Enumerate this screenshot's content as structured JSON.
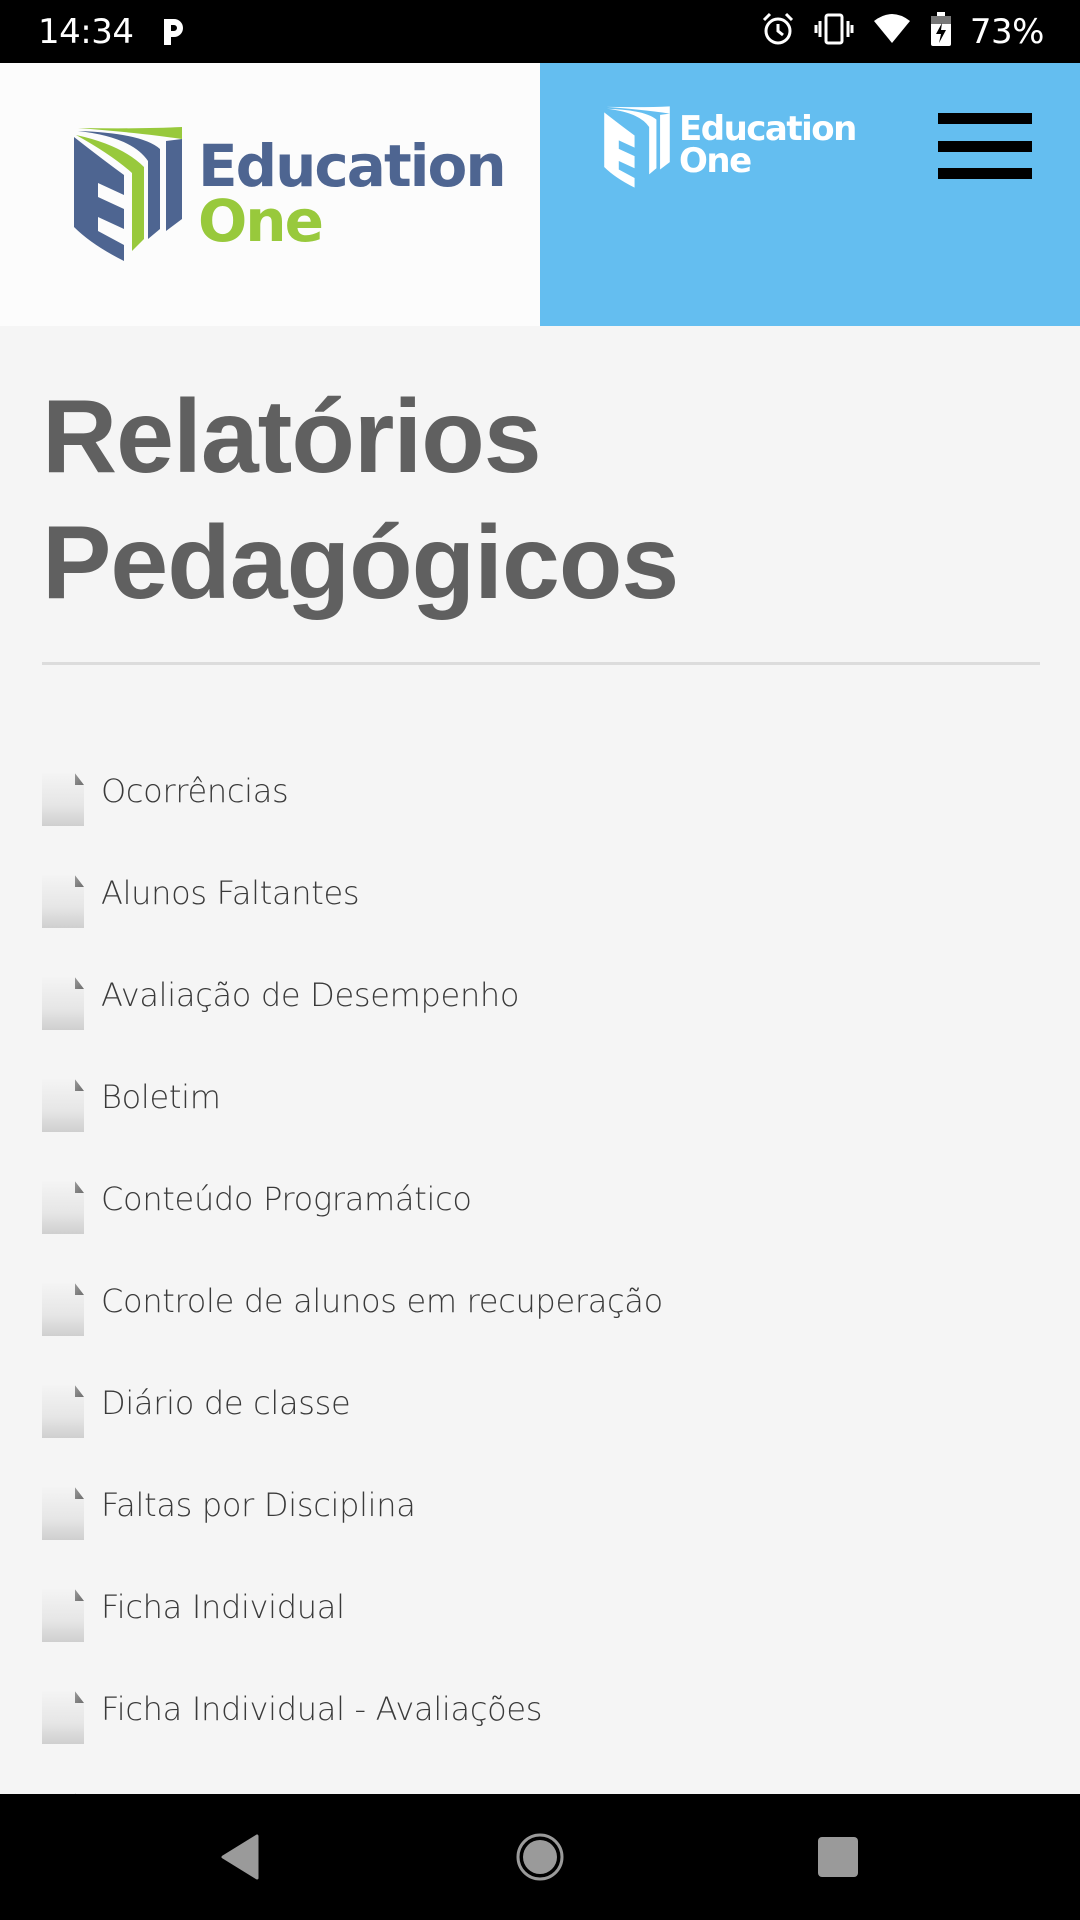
{
  "status_bar": {
    "time": "14:34",
    "notification_icon": "parking-p-icon",
    "icons": [
      "alarm-icon",
      "vibrate-icon",
      "wifi-icon",
      "battery-charging-icon"
    ],
    "battery_percent": "73%"
  },
  "header": {
    "logo_primary": {
      "line1": "Education",
      "line2": "One"
    },
    "logo_secondary": {
      "line1": "Education",
      "line2": "One"
    },
    "menu_icon": "hamburger-menu-icon",
    "colors": {
      "left_bg": "#fcfcfc",
      "right_bg": "#64bef0",
      "brand_blue": "#4e6591",
      "brand_green": "#98c93c"
    }
  },
  "main": {
    "title_line1": "Relatórios",
    "title_line2": "Pedagógicos",
    "reports": [
      {
        "label": "Ocorrências",
        "icon": "document-icon"
      },
      {
        "label": "Alunos Faltantes",
        "icon": "document-icon"
      },
      {
        "label": "Avaliação de Desempenho",
        "icon": "document-icon"
      },
      {
        "label": "Boletim",
        "icon": "document-icon"
      },
      {
        "label": "Conteúdo Programático",
        "icon": "document-icon"
      },
      {
        "label": "Controle de alunos em recuperação",
        "icon": "document-icon"
      },
      {
        "label": "Diário de classe",
        "icon": "document-icon"
      },
      {
        "label": "Faltas por Disciplina",
        "icon": "document-icon"
      },
      {
        "label": "Ficha Individual",
        "icon": "document-icon"
      },
      {
        "label": "Ficha Individual - Avaliações",
        "icon": "document-icon"
      },
      {
        "label": "",
        "icon": "document-icon"
      }
    ]
  },
  "nav_bar": {
    "buttons": [
      "back-icon",
      "home-icon",
      "recents-icon"
    ]
  }
}
